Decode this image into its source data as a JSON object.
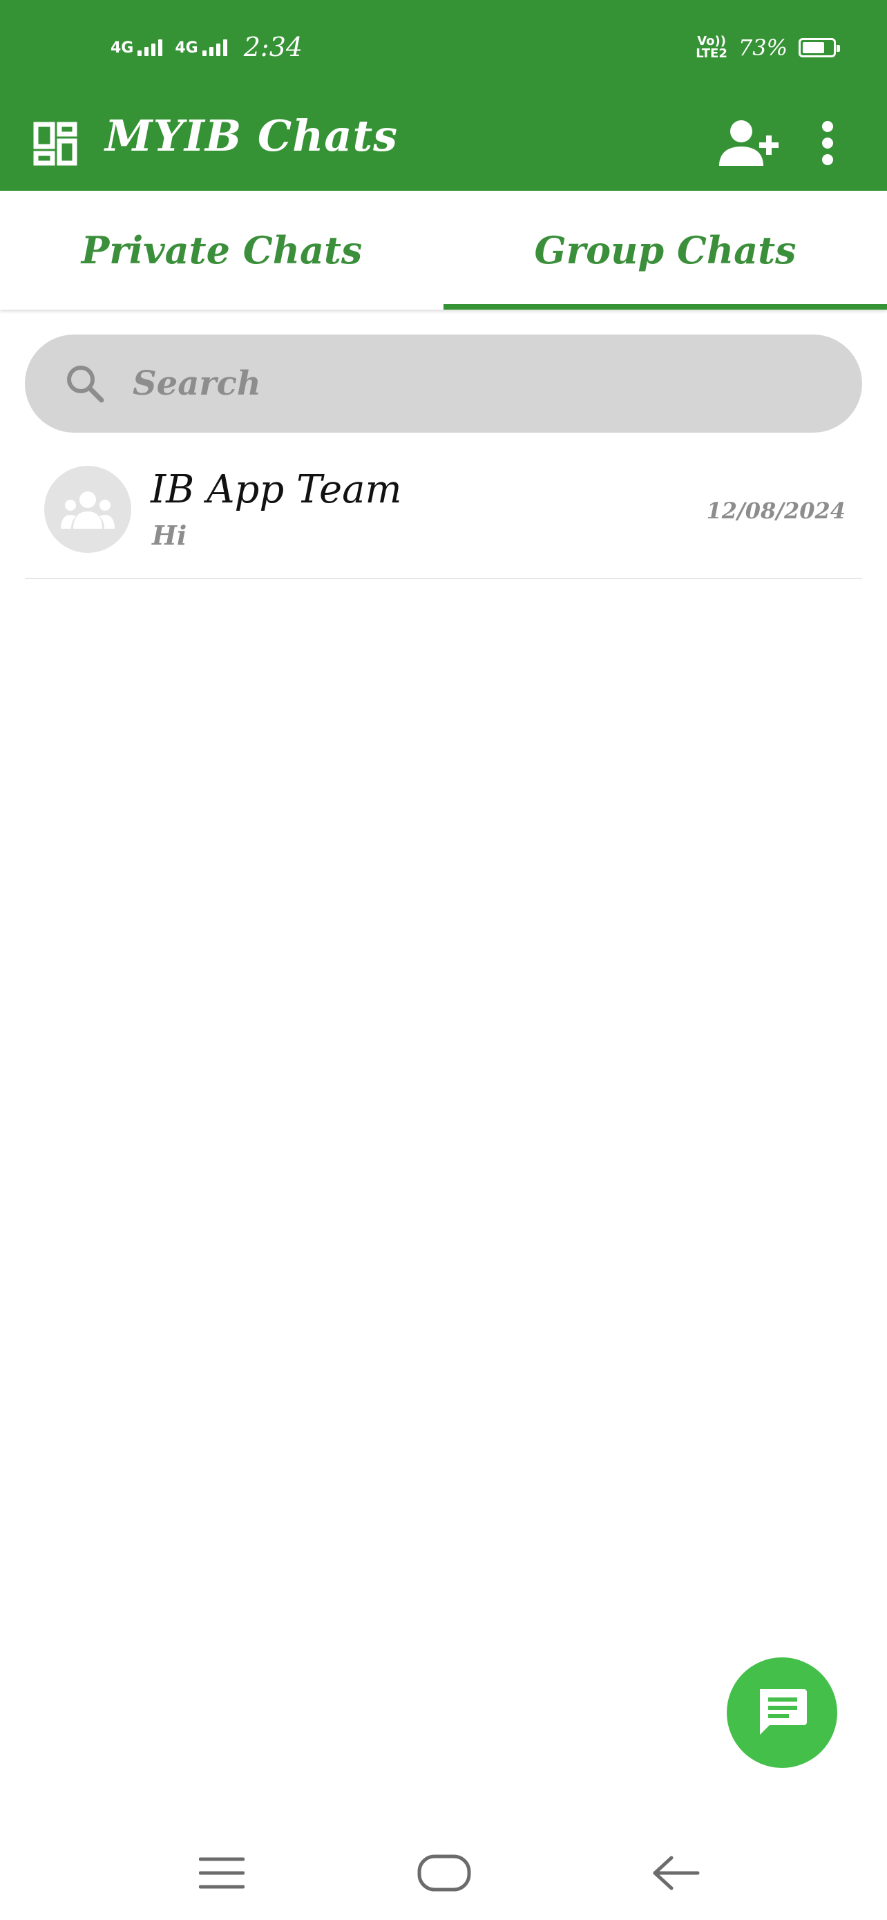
{
  "status_bar": {
    "network1": "4G",
    "network2": "4G",
    "time": "2:34",
    "volte_line1": "Vo))",
    "volte_line2": "LTE2",
    "battery_percent": "73%",
    "battery_level": 0.73
  },
  "app_bar": {
    "title": "MYIB Chats",
    "icons": [
      "dashboard-icon",
      "add-person-icon",
      "more-vert-icon"
    ]
  },
  "tabs": [
    {
      "label": "Private Chats",
      "active": false
    },
    {
      "label": "Group Chats",
      "active": true
    }
  ],
  "search": {
    "placeholder": "Search",
    "icon": "search-icon"
  },
  "chats": [
    {
      "name": "IB App Team",
      "last_message": "Hi",
      "date": "12/08/2024",
      "avatar_icon": "group-icon"
    }
  ],
  "fab": {
    "icon": "message-icon"
  },
  "nav_bar": {
    "icons": [
      "menu-icon",
      "home-icon",
      "back-icon"
    ]
  },
  "colors": {
    "primary": "#359335",
    "tab_text": "#3b8f3b",
    "fab": "#44c04a",
    "search_bg": "#d5d5d5",
    "muted_text": "#8d8d8d"
  }
}
